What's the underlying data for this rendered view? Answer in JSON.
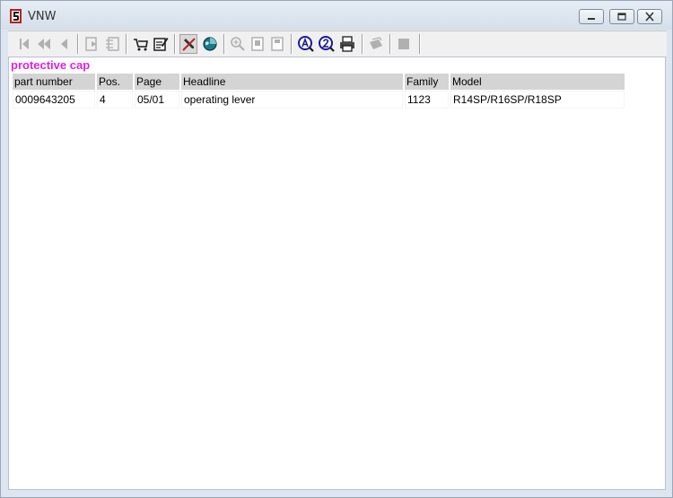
{
  "window": {
    "title": "VNW",
    "buttons": {
      "minimize": "minimize",
      "maximize": "maximize",
      "close": "close"
    }
  },
  "toolbar": {
    "buttons": [
      {
        "icon": "first-record-icon",
        "enabled": false
      },
      {
        "icon": "previous-page-icon",
        "enabled": false
      },
      {
        "icon": "previous-record-icon",
        "enabled": false
      },
      {
        "icon": "export-left-icon",
        "enabled": false
      },
      {
        "icon": "export-right-icon",
        "enabled": false
      },
      {
        "icon": "shopping-cart-icon",
        "enabled": true
      },
      {
        "icon": "edit-note-icon",
        "enabled": true
      },
      {
        "icon": "pencil-tool-icon",
        "enabled": true,
        "pressed": true
      },
      {
        "icon": "globe-icon",
        "enabled": true
      },
      {
        "icon": "zoom-in-icon",
        "enabled": false
      },
      {
        "icon": "page-icon",
        "enabled": false
      },
      {
        "icon": "page-alt-icon",
        "enabled": false
      },
      {
        "icon": "search-a-icon",
        "enabled": true
      },
      {
        "icon": "search-2-icon",
        "enabled": true
      },
      {
        "icon": "print-icon",
        "enabled": true
      },
      {
        "icon": "stack-icon",
        "enabled": false
      },
      {
        "icon": "block-icon",
        "enabled": false
      }
    ]
  },
  "colors": {
    "part_title": "#dd22dd",
    "link": "#2222aa",
    "header_bg": "#d4d4d4"
  },
  "part": {
    "title": "protective cap"
  },
  "table": {
    "headers": [
      "part number",
      "Pos.",
      "Page",
      "Headline",
      "Family",
      "Model"
    ],
    "rows": [
      [
        "0009643205",
        "4",
        "05/01",
        "operating lever",
        "1123",
        "R14SP/R16SP/R18SP"
      ]
    ]
  }
}
